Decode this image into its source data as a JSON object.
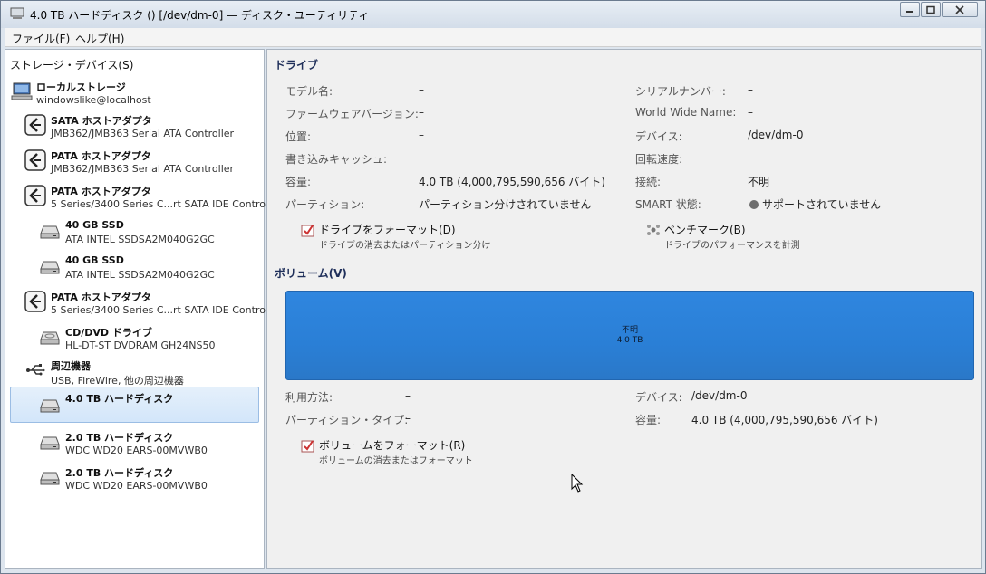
{
  "window": {
    "title": "4.0 TB ハードディスク () [/dev/dm-0] — ディスク・ユーティリティ"
  },
  "menu": {
    "file": "ファイル(F)",
    "help": "ヘルプ(H)"
  },
  "sidebar": {
    "header": "ストレージ・デバイス(S)",
    "items": [
      {
        "title": "ローカルストレージ",
        "subtitle": "windowslike@localhost",
        "icon": "computer-icon"
      },
      {
        "title": "SATA ホストアダプタ",
        "subtitle": "JMB362/JMB363 Serial ATA Controller",
        "icon": "host-adapter-icon"
      },
      {
        "title": "PATA ホストアダプタ",
        "subtitle": "JMB362/JMB363 Serial ATA Controller",
        "icon": "host-adapter-icon"
      },
      {
        "title": "PATA ホストアダプタ",
        "subtitle": "5 Series/3400 Series C...rt SATA IDE Controller",
        "icon": "host-adapter-icon"
      },
      {
        "title": "40 GB SSD",
        "subtitle": "ATA INTEL SSDSA2M040G2GC",
        "icon": "drive-icon"
      },
      {
        "title": "40 GB SSD",
        "subtitle": "ATA INTEL SSDSA2M040G2GC",
        "icon": "drive-icon"
      },
      {
        "title": "PATA ホストアダプタ",
        "subtitle": "5 Series/3400 Series C...rt SATA IDE Controller",
        "icon": "host-adapter-icon"
      },
      {
        "title": "CD/DVD ドライブ",
        "subtitle": "HL-DT-ST DVDRAM GH24NS50",
        "icon": "optical-drive-icon"
      },
      {
        "title": "周辺機器",
        "subtitle": "USB, FireWire, 他の周辺機器",
        "icon": "usb-icon"
      },
      {
        "title": "4.0 TB ハードディスク",
        "subtitle": "",
        "icon": "drive-icon"
      },
      {
        "title": "2.0 TB ハードディスク",
        "subtitle": "WDC WD20 EARS-00MVWB0",
        "icon": "drive-icon"
      },
      {
        "title": "2.0 TB ハードディスク",
        "subtitle": "WDC WD20 EARS-00MVWB0",
        "icon": "drive-icon"
      }
    ]
  },
  "drive": {
    "section_title": "ドライブ",
    "left": [
      {
        "label": "モデル名:",
        "value": "–"
      },
      {
        "label": "ファームウェアバージョン:",
        "value": "–"
      },
      {
        "label": "位置:",
        "value": "–"
      },
      {
        "label": "書き込みキャッシュ:",
        "value": "–"
      },
      {
        "label": "容量:",
        "value": "4.0 TB (4,000,795,590,656 バイト)"
      },
      {
        "label": "パーティション:",
        "value": "パーティション分けされていません"
      }
    ],
    "right": [
      {
        "label": "シリアルナンバー:",
        "value": "–"
      },
      {
        "label": "World Wide Name:",
        "value": "–"
      },
      {
        "label": "デバイス:",
        "value": "/dev/dm-0"
      },
      {
        "label": "回転速度:",
        "value": "–"
      },
      {
        "label": "接続:",
        "value": "不明"
      },
      {
        "label": "SMART 状態:",
        "value": "サポートされていません"
      }
    ],
    "format_action": {
      "label": "ドライブをフォーマット(D)",
      "sub": "ドライブの消去またはパーティション分け"
    },
    "benchmark_action": {
      "label": "ベンチマーク(B)",
      "sub": "ドライブのパフォーマンスを計測"
    }
  },
  "volume": {
    "section_title": "ボリューム(V)",
    "bar_line1": "不明",
    "bar_line2": "4.0 TB",
    "bar_color": "#2b80d8",
    "left": [
      {
        "label": "利用方法:",
        "value": "–"
      },
      {
        "label": "パーティション・タイプ:",
        "value": "–"
      }
    ],
    "right": [
      {
        "label": "デバイス:",
        "value": "/dev/dm-0"
      },
      {
        "label": "容量:",
        "value": "4.0 TB (4,000,795,590,656 バイト)"
      }
    ],
    "format_action": {
      "label": "ボリュームをフォーマット(R)",
      "sub": "ボリュームの消去またはフォーマット"
    }
  }
}
